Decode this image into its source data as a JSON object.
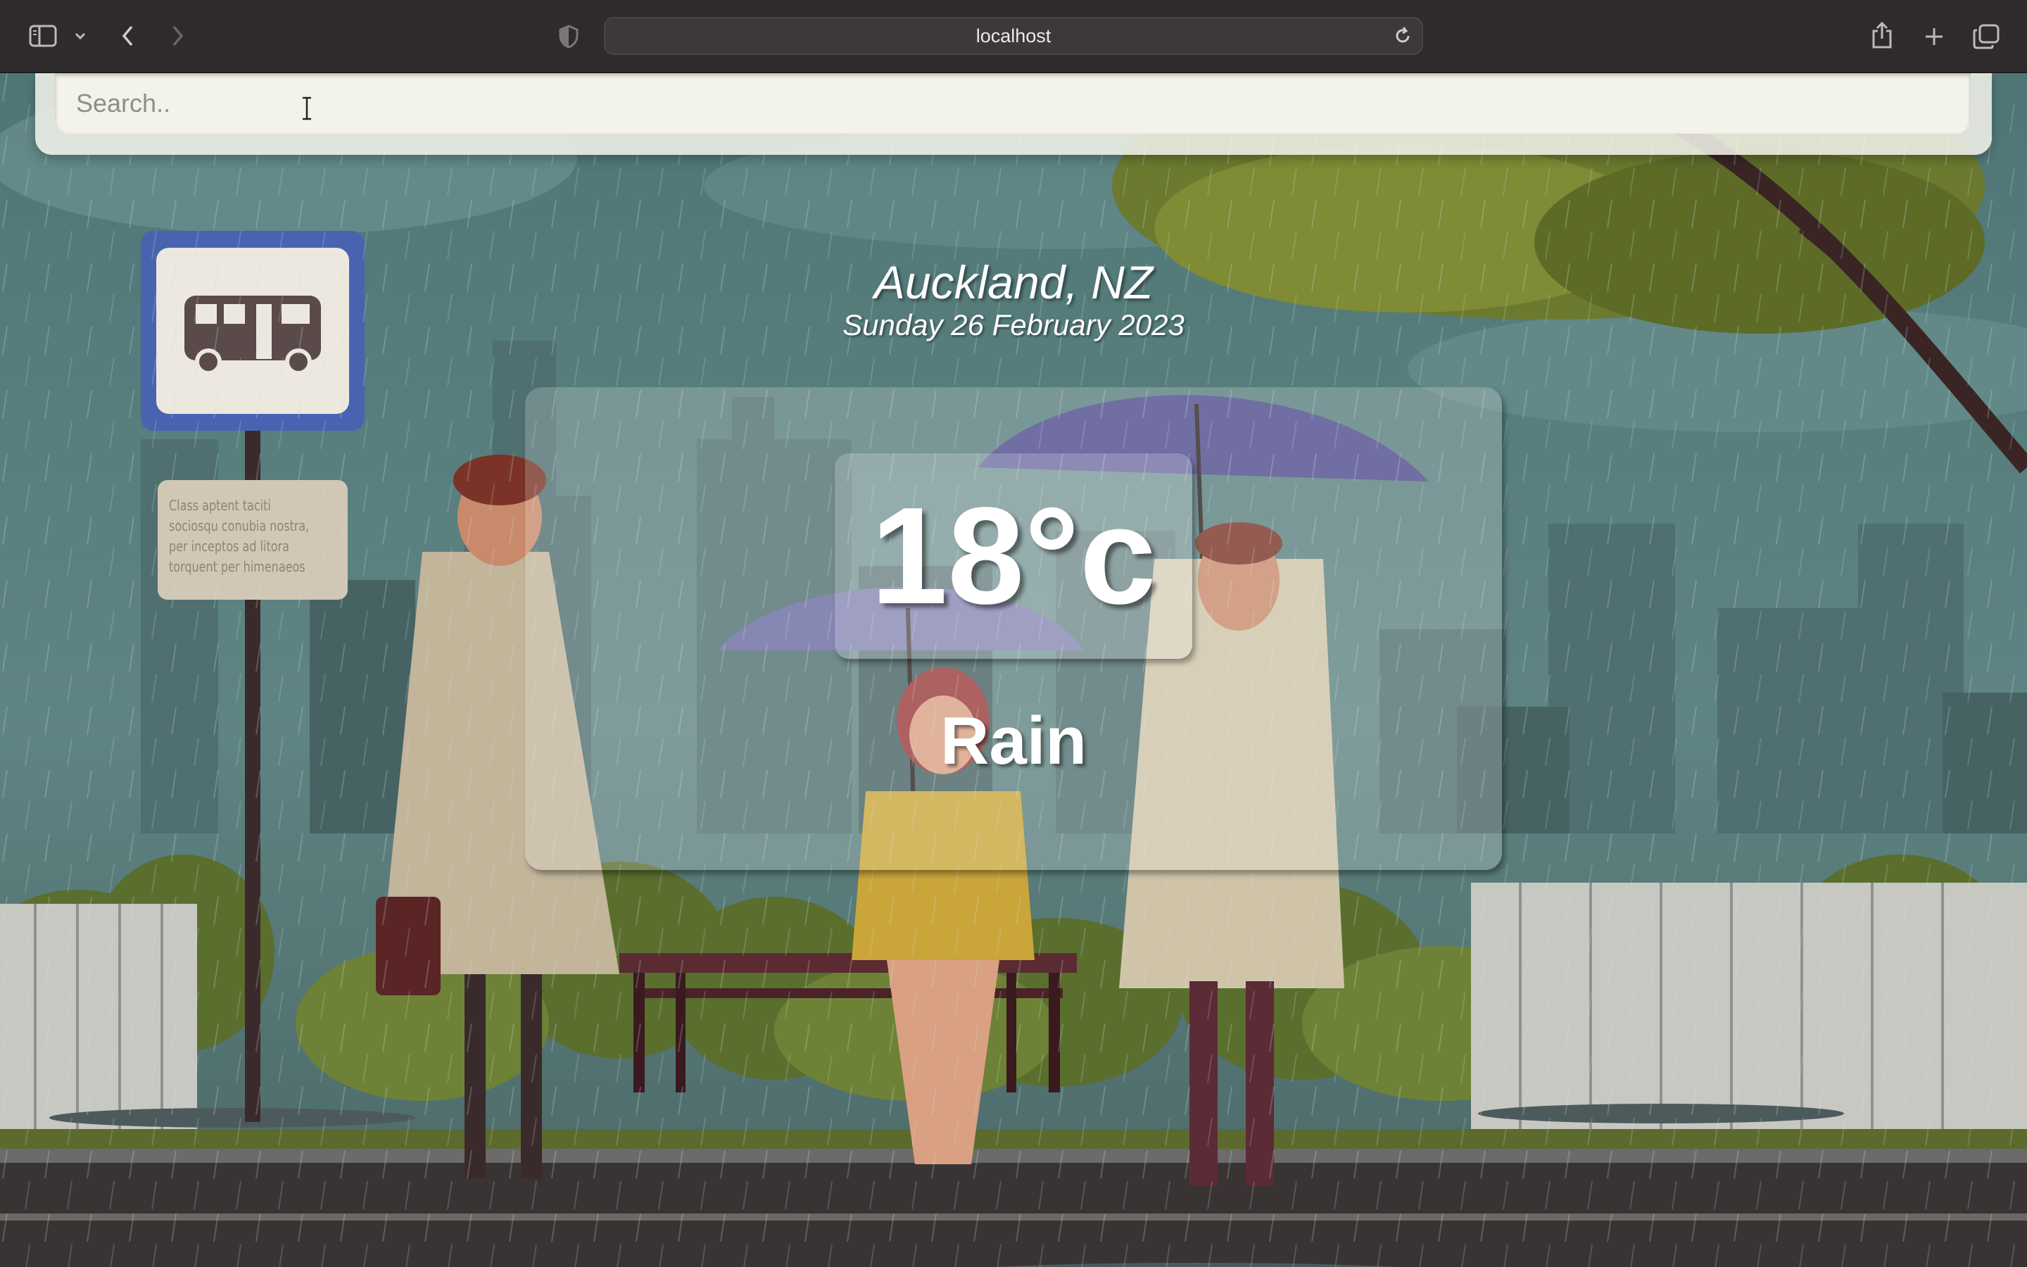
{
  "browser": {
    "address": "localhost",
    "icons": {
      "sidebar": "sidebar-icon",
      "sidebar_menu": "chevron-down-icon",
      "back": "chevron-left-icon",
      "forward": "chevron-right-icon",
      "privacy": "shield-icon",
      "reload": "reload-icon",
      "share": "share-icon",
      "new_tab": "plus-icon",
      "tabs": "tabs-overview-icon"
    }
  },
  "search": {
    "placeholder": "Search..",
    "value": ""
  },
  "location": {
    "city": "Auckland, NZ",
    "date": "Sunday 26 February 2023"
  },
  "weather": {
    "temperature": "18°c",
    "condition": "Rain"
  },
  "background": {
    "theme": "rainy-bus-stop-illustration",
    "bus_sign_text": "Class aptent taciti sociosqu conubia nostra, per inceptos ad litora torquent per himenaeos"
  },
  "colors": {
    "chrome": "#2f2a2b",
    "sky": "#5d7f80",
    "text": "#ffffff"
  }
}
